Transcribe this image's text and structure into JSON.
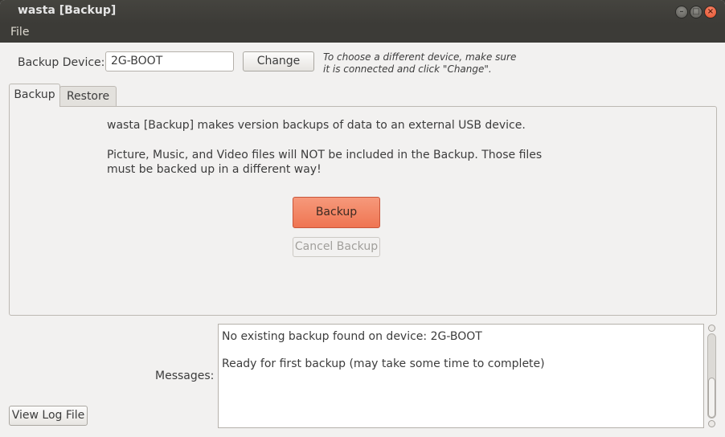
{
  "window": {
    "title": "wasta [Backup]",
    "controls": [
      "minimize",
      "maximize",
      "close"
    ]
  },
  "menubar": {
    "file_label": "File"
  },
  "device": {
    "label": "Backup Device:",
    "value": "2G-BOOT",
    "change_label": "Change",
    "hint_line1": "To choose a different device, make sure",
    "hint_line2": "it is connected and click \"Change\"."
  },
  "tabs": [
    {
      "label": "Backup",
      "active": true
    },
    {
      "label": "Restore",
      "active": false
    }
  ],
  "backup_panel": {
    "intro": "wasta [Backup] makes version backups of data to an external USB device.",
    "warning_line1": "Picture, Music, and Video files will NOT be included in the Backup.  Those files",
    "warning_line2": "must be backed up in a different way!",
    "backup_label": "Backup",
    "cancel_label": "Cancel Backup"
  },
  "messages": {
    "label": "Messages:",
    "lines": [
      "No existing backup found on device: 2G-BOOT",
      "Ready for first backup (may take some time to complete)"
    ]
  },
  "log": {
    "view_label": "View Log File"
  },
  "colors": {
    "accent": "#ef7552",
    "titlebar": "#3c3b37",
    "window_bg": "#f2f1f0"
  }
}
